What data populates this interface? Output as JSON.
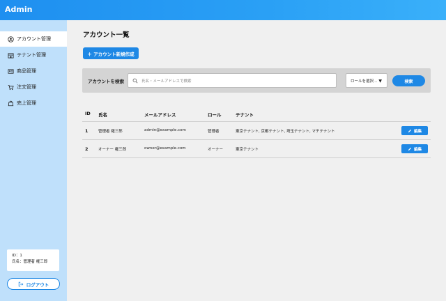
{
  "app": {
    "brand": "Admin"
  },
  "sidebar": {
    "items": [
      {
        "label": "アカウント管理",
        "icon": "account-circle-icon",
        "active": true
      },
      {
        "label": "テナント管理",
        "icon": "tenant-icon",
        "active": false
      },
      {
        "label": "商品管理",
        "icon": "product-icon",
        "active": false
      },
      {
        "label": "注文管理",
        "icon": "cart-icon",
        "active": false
      },
      {
        "label": "売上管理",
        "icon": "sales-icon",
        "active": false
      }
    ],
    "user": {
      "id_line": "ID：1",
      "name_line": "氏名：管理者 権三郎"
    },
    "logout_label": "ログアウト"
  },
  "main": {
    "title": "アカウント一覧",
    "create_label": "＋ アカウント新規作成",
    "search": {
      "label": "アカウントを検索",
      "placeholder": "氏名・メールアドレスで検索",
      "role_select": "ロールを選択...",
      "button": "検索"
    },
    "table": {
      "headers": [
        "ID",
        "氏名",
        "メールアドレス",
        "ロール",
        "テナント"
      ],
      "rows": [
        {
          "id": "1",
          "name": "管理者 権三郎",
          "email": "admin@example.com",
          "role": "管理者",
          "tenant": "東京テナント, 京都テナント, 埼玉テナント, マチテナント",
          "edit": "編集"
        },
        {
          "id": "2",
          "name": "オーナー 権三郎",
          "email": "owner@example.com",
          "role": "オーナー",
          "tenant": "東京テナント",
          "edit": "編集"
        }
      ]
    }
  },
  "colors": {
    "accent": "#1e88e5",
    "sidebar": "#bfe0fb",
    "background": "#f0f0f0"
  }
}
